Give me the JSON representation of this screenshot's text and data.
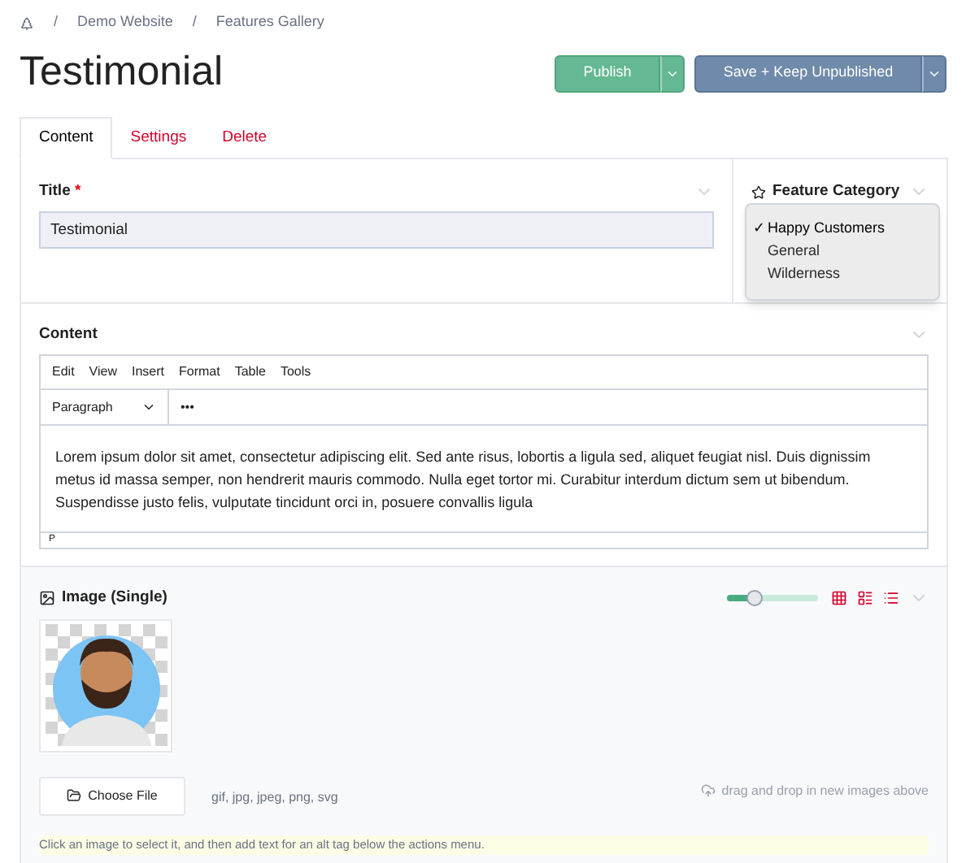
{
  "breadcrumb": {
    "separator": "/",
    "items": [
      "Demo Website",
      "Features Gallery"
    ]
  },
  "page_title": "Testimonial",
  "actions": [
    {
      "label": "Publish",
      "kind": "publish"
    },
    {
      "label": "Save + Keep Unpublished",
      "kind": "save"
    }
  ],
  "tabs": [
    {
      "label": "Content",
      "selected": true
    },
    {
      "label": "Settings",
      "selected": false
    },
    {
      "label": "Delete",
      "selected": false
    }
  ],
  "title_field": {
    "label": "Title",
    "required_mark": "*",
    "value": "Testimonial"
  },
  "feature_category": {
    "label": "Feature Category",
    "check_mark": "✓",
    "options": [
      {
        "label": "Happy Customers",
        "selected": true
      },
      {
        "label": "General",
        "selected": false
      },
      {
        "label": "Wilderness",
        "selected": false
      }
    ]
  },
  "content_editor": {
    "label": "Content",
    "menu": [
      "Edit",
      "View",
      "Insert",
      "Format",
      "Table",
      "Tools"
    ],
    "block_format": "Paragraph",
    "more": "•••",
    "body": "Lorem ipsum dolor sit amet, consectetur adipiscing elit. Sed ante risus, lobortis a ligula sed, aliquet feugiat nisl. Duis dignissim metus id massa semper, non hendrerit mauris commodo. Nulla eget tortor mi. Curabitur interdum dictum sem ut bibendum. Suspendisse justo felis, vulputate tincidunt orci in, posuere convallis ligula",
    "path": "P"
  },
  "image_section": {
    "label": "Image (Single)",
    "size_slider": {
      "level": 0.3
    },
    "choose_file": "Choose File",
    "file_types": "gif, jpg, jpeg, png, svg",
    "drop_hint": "drag and drop in new images above",
    "help": "Click an image to select it, and then add text for an alt tag below the actions menu."
  }
}
